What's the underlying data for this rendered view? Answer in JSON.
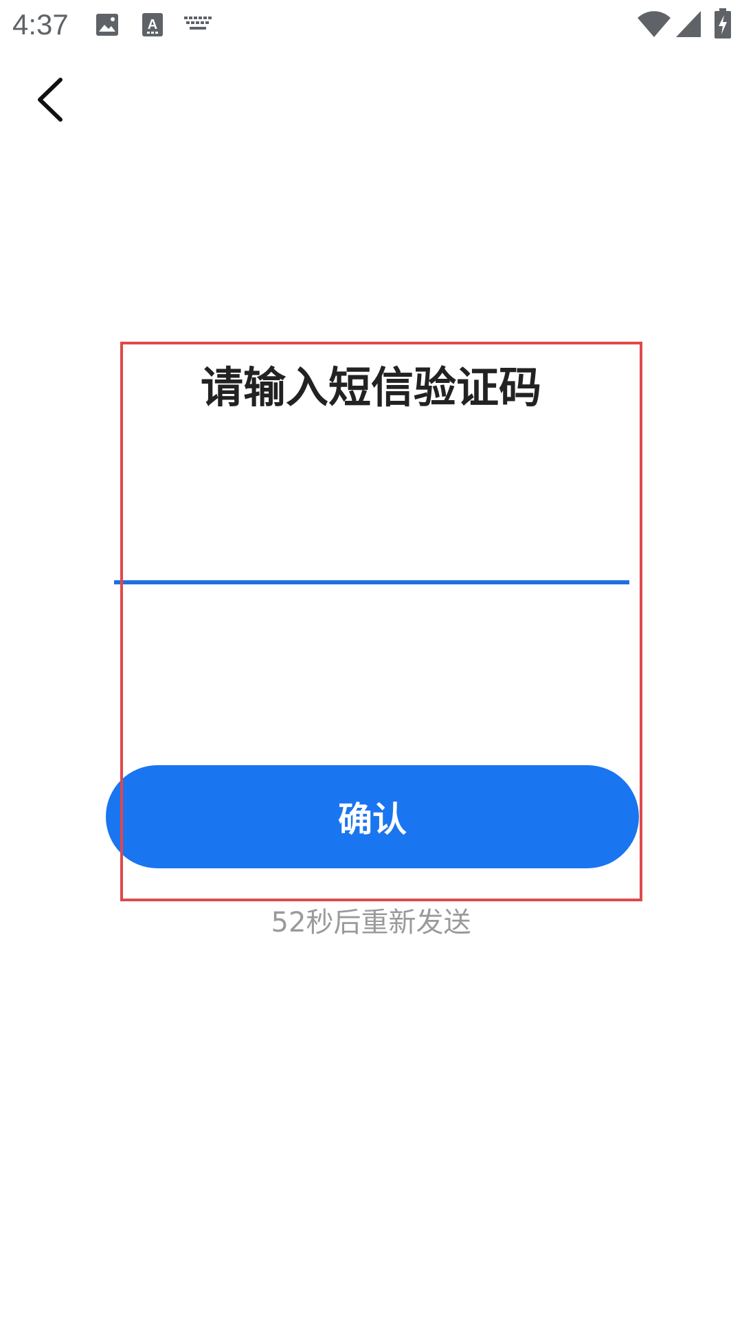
{
  "status_bar": {
    "time": "4:37",
    "icons": [
      "image-icon",
      "text-a-icon",
      "keyboard-icon",
      "wifi-icon",
      "signal-icon",
      "battery-charging-icon"
    ]
  },
  "nav": {
    "back_icon": "chevron-left-icon"
  },
  "form": {
    "title": "请输入短信验证码",
    "code_value": "",
    "confirm_label": "确认",
    "resend_text": "52秒后重新发送"
  },
  "colors": {
    "primary": "#1a75f0",
    "underline": "#1f6fe0",
    "highlight": "#e04848",
    "title_text": "#222222",
    "muted_text": "#9a9a9a"
  }
}
